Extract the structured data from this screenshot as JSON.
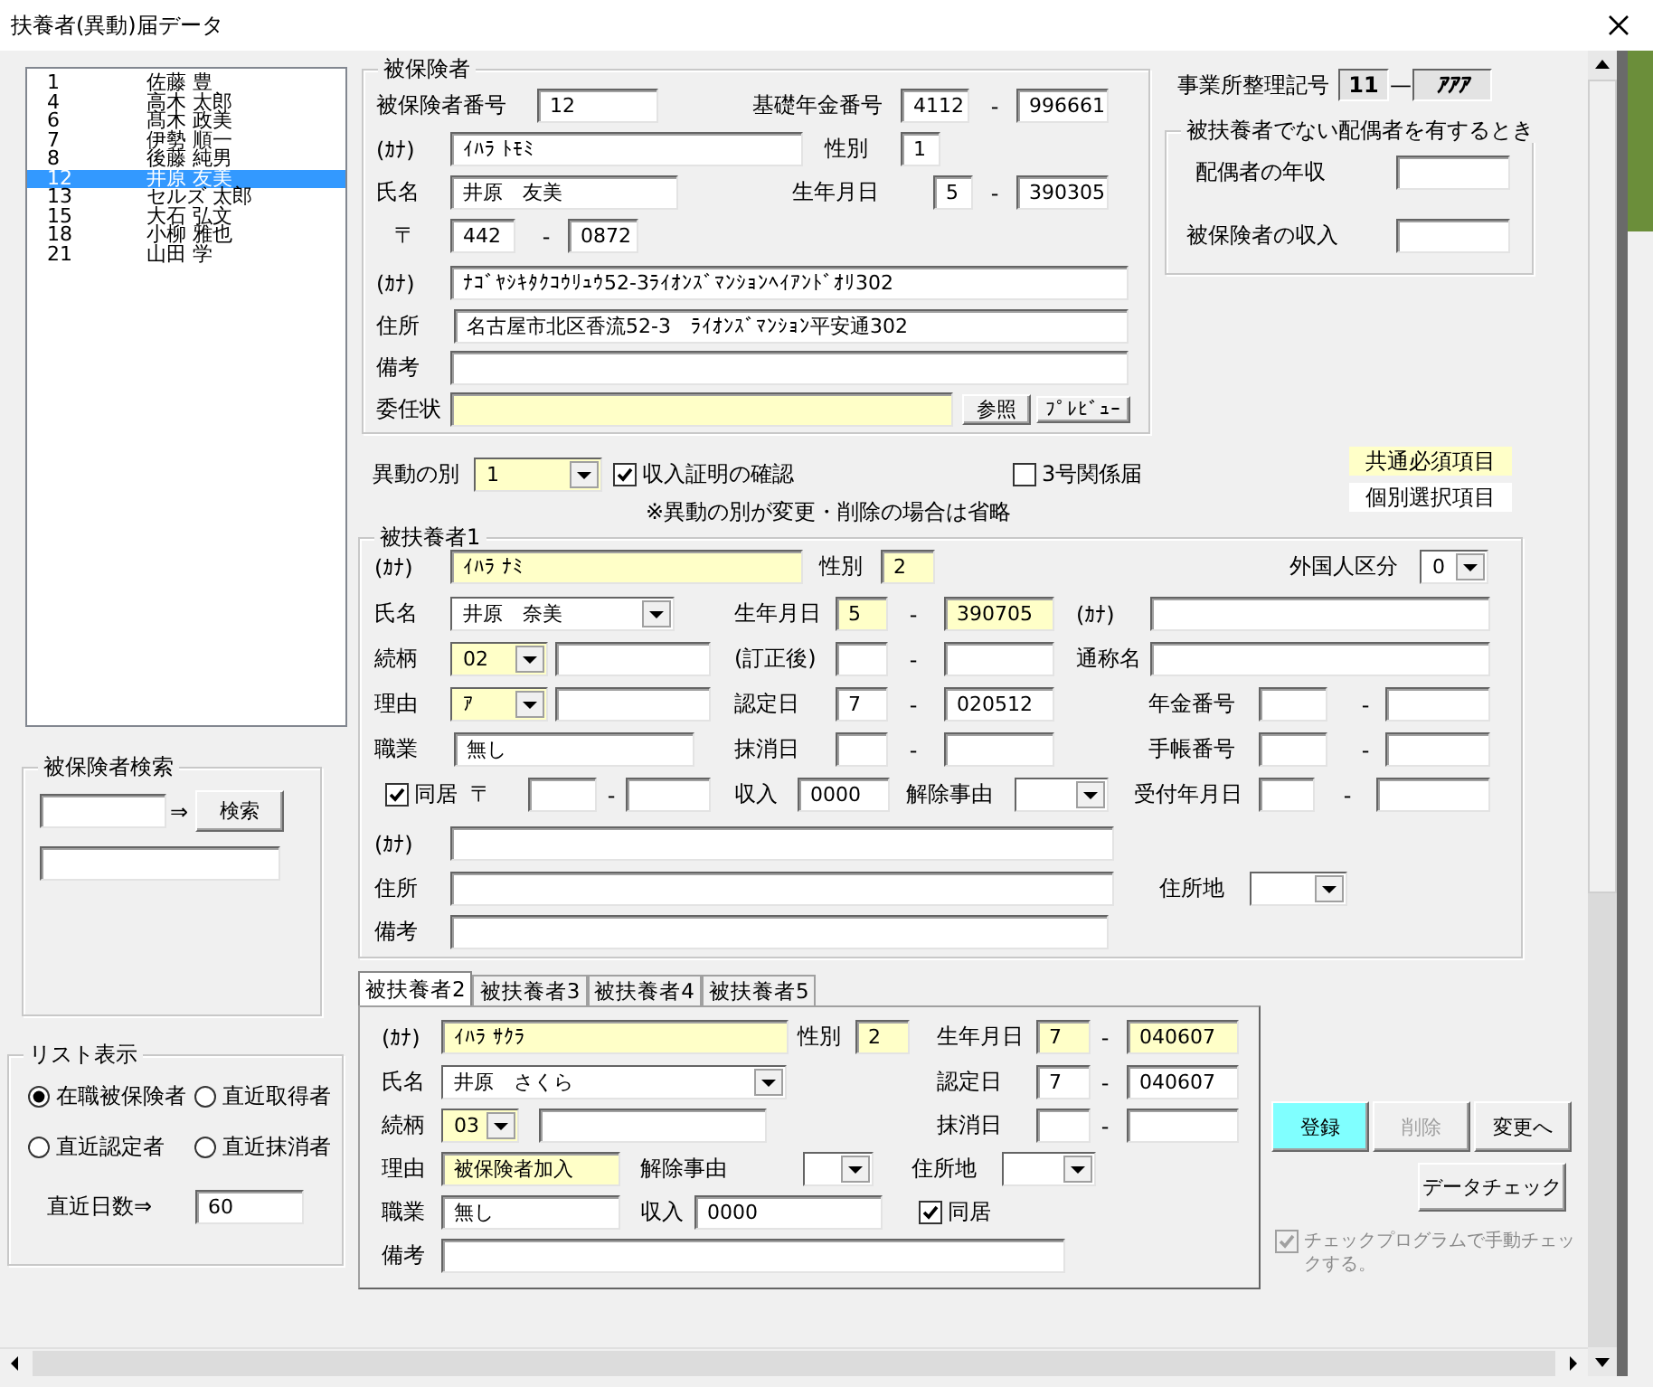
{
  "window": {
    "title": "扶養者(異動)届データ"
  },
  "insured_list": [
    {
      "number": "1",
      "name": "佐藤 豊",
      "selected": false
    },
    {
      "number": "4",
      "name": "高木 太郎",
      "selected": false
    },
    {
      "number": "6",
      "name": "髙木 政美",
      "selected": false
    },
    {
      "number": "7",
      "name": "伊勢 順一",
      "selected": false
    },
    {
      "number": "8",
      "name": "後藤 純男",
      "selected": false
    },
    {
      "number": "12",
      "name": "井原 友美",
      "selected": true
    },
    {
      "number": "13",
      "name": "セルズ 太郎",
      "selected": false
    },
    {
      "number": "15",
      "name": "大石 弘文",
      "selected": false
    },
    {
      "number": "18",
      "name": "小柳 雅也",
      "selected": false
    },
    {
      "number": "21",
      "name": "山田 学",
      "selected": false
    }
  ],
  "search": {
    "title": "被保険者検索",
    "arrow": "⇒",
    "button": "検索"
  },
  "list_display": {
    "title": "リスト表示",
    "options": [
      {
        "label": "在職被保険者",
        "selected": true
      },
      {
        "label": "直近取得者",
        "selected": false
      },
      {
        "label": "直近認定者",
        "selected": false
      },
      {
        "label": "直近抹消者",
        "selected": false
      }
    ],
    "days_label": "直近日数⇒",
    "days": "60"
  },
  "insured": {
    "title": "被保険者",
    "lines": [
      {
        "controls": [
          {
            "kind": "label",
            "text": "被保険者番号"
          },
          {
            "kind": "field",
            "value": "12",
            "required": false
          },
          {
            "kind": "label",
            "text": "基礎年金番号"
          },
          {
            "kind": "field",
            "value": "4112",
            "required": false
          },
          {
            "kind": "dash",
            "text": "-"
          },
          {
            "kind": "field",
            "value": "996661",
            "required": false
          }
        ]
      },
      {
        "controls": [
          {
            "kind": "label",
            "text": "(ｶﾅ)"
          },
          {
            "kind": "field",
            "value": "ｲﾊﾗ ﾄﾓﾐ",
            "required": false
          },
          {
            "kind": "label",
            "text": "性別"
          },
          {
            "kind": "field",
            "value": "1",
            "required": false
          }
        ]
      },
      {
        "controls": [
          {
            "kind": "label",
            "text": "氏名"
          },
          {
            "kind": "field",
            "value": "井原　友美",
            "required": false
          },
          {
            "kind": "label",
            "text": "生年月日"
          },
          {
            "kind": "field",
            "value": "5",
            "required": false
          },
          {
            "kind": "dash",
            "text": "-"
          },
          {
            "kind": "field",
            "value": "390305",
            "required": false
          }
        ]
      },
      {
        "controls": [
          {
            "kind": "label",
            "text": "〒"
          },
          {
            "kind": "field",
            "value": "442",
            "required": false
          },
          {
            "kind": "dash",
            "text": "-"
          },
          {
            "kind": "field",
            "value": "0872",
            "required": false
          }
        ]
      },
      {
        "controls": [
          {
            "kind": "label",
            "text": "(ｶﾅ)"
          },
          {
            "kind": "field",
            "value": "ﾅｺﾞﾔｼｷﾀｸｺｳﾘｭｳ52-3ﾗｲｵﾝｽﾞﾏﾝｼｮﾝﾍｲｱﾝﾄﾞｵﾘ302",
            "required": false
          }
        ]
      },
      {
        "controls": [
          {
            "kind": "label",
            "text": "住所"
          },
          {
            "kind": "field",
            "value": "名古屋市北区香流52-3　ﾗｲｵﾝｽﾞﾏﾝｼｮﾝ平安通302",
            "required": false
          }
        ]
      },
      {
        "controls": [
          {
            "kind": "label",
            "text": "備考"
          },
          {
            "kind": "field",
            "required": false
          }
        ]
      },
      {
        "controls": [
          {
            "kind": "label",
            "text": "委任状"
          },
          {
            "kind": "field",
            "required": true
          },
          {
            "kind": "button",
            "label": "参照"
          },
          {
            "kind": "button",
            "label": "ﾌﾟﾚﾋﾞｭｰ"
          }
        ]
      }
    ]
  },
  "office_code": {
    "label": "事業所整理記号",
    "part1": "11",
    "separator": "—",
    "part2": "ｱｱｱ"
  },
  "spouse": {
    "title": "被扶養者でない配偶者を有するとき",
    "lines": [
      {
        "controls": [
          {
            "kind": "label",
            "text": "配偶者の年収"
          },
          {
            "kind": "field",
            "required": false
          }
        ]
      },
      {
        "controls": [
          {
            "kind": "label",
            "text": "被保険者の収入"
          },
          {
            "kind": "field",
            "required": false
          }
        ]
      }
    ]
  },
  "legend": [
    {
      "text": "共通必須項目",
      "required": true
    },
    {
      "text": "個別選択項目",
      "required": false
    }
  ],
  "change_section": {
    "lines": [
      {
        "controls": [
          {
            "kind": "label",
            "text": "異動の別"
          },
          {
            "kind": "combo",
            "value": "1",
            "required": true
          },
          {
            "kind": "check",
            "label": "収入証明の確認",
            "checked": true
          },
          {
            "kind": "check",
            "label": "3号関係届",
            "checked": false
          }
        ]
      },
      {
        "controls": [
          {
            "kind": "label",
            "text": "※異動の別が変更・削除の場合は省略"
          }
        ]
      }
    ]
  },
  "dependent1": {
    "title": "被扶養者1",
    "lines": [
      {
        "controls": [
          {
            "kind": "label",
            "text": "(ｶﾅ)"
          },
          {
            "kind": "field",
            "value": "ｲﾊﾗ ﾅﾐ",
            "required": true
          },
          {
            "kind": "label",
            "text": "性別"
          },
          {
            "kind": "field",
            "value": "2",
            "required": true
          },
          {
            "kind": "label",
            "text": "外国人区分"
          },
          {
            "kind": "combo",
            "value": "0",
            "required": false
          }
        ]
      },
      {
        "controls": [
          {
            "kind": "label",
            "text": "氏名"
          },
          {
            "kind": "combo",
            "value": "井原　奈美",
            "required": false
          },
          {
            "kind": "label",
            "text": "生年月日"
          },
          {
            "kind": "field",
            "value": "5",
            "required": true
          },
          {
            "kind": "dash",
            "text": "-"
          },
          {
            "kind": "field",
            "value": "390705",
            "required": true
          },
          {
            "kind": "label",
            "text": "(ｶﾅ)"
          },
          {
            "kind": "field",
            "required": false
          }
        ]
      },
      {
        "controls": [
          {
            "kind": "label",
            "text": "続柄"
          },
          {
            "kind": "combo",
            "value": "02",
            "required": true
          },
          {
            "kind": "field",
            "required": false
          },
          {
            "kind": "label",
            "text": "(訂正後)"
          },
          {
            "kind": "field",
            "required": false
          },
          {
            "kind": "dash",
            "text": "-"
          },
          {
            "kind": "field",
            "required": false
          },
          {
            "kind": "label",
            "text": "通称名"
          },
          {
            "kind": "field",
            "required": false
          }
        ]
      },
      {
        "controls": [
          {
            "kind": "label",
            "text": "理由"
          },
          {
            "kind": "combo",
            "value": "ｱ",
            "required": true
          },
          {
            "kind": "field",
            "required": false
          },
          {
            "kind": "label",
            "text": "認定日"
          },
          {
            "kind": "field",
            "value": "7",
            "required": false
          },
          {
            "kind": "dash",
            "text": "-"
          },
          {
            "kind": "field",
            "value": "020512",
            "required": false
          },
          {
            "kind": "label",
            "text": "年金番号"
          },
          {
            "kind": "field",
            "required": false
          },
          {
            "kind": "dash",
            "text": "-"
          },
          {
            "kind": "field",
            "required": false
          }
        ]
      },
      {
        "controls": [
          {
            "kind": "label",
            "text": "職業"
          },
          {
            "kind": "field",
            "value": "無し",
            "required": false
          },
          {
            "kind": "label",
            "text": "抹消日"
          },
          {
            "kind": "field",
            "required": false
          },
          {
            "kind": "dash",
            "text": "-"
          },
          {
            "kind": "field",
            "required": false
          },
          {
            "kind": "label",
            "text": "手帳番号"
          },
          {
            "kind": "field",
            "required": false
          },
          {
            "kind": "dash",
            "text": "-"
          },
          {
            "kind": "field",
            "required": false
          }
        ]
      },
      {
        "controls": [
          {
            "kind": "check",
            "label": "同居",
            "checked": true
          },
          {
            "kind": "label",
            "text": "〒"
          },
          {
            "kind": "field",
            "required": false
          },
          {
            "kind": "dash",
            "text": "-"
          },
          {
            "kind": "field",
            "required": false
          },
          {
            "kind": "label",
            "text": "収入"
          },
          {
            "kind": "field",
            "value": "0000",
            "required": false
          },
          {
            "kind": "label",
            "text": "解除事由"
          },
          {
            "kind": "combo",
            "required": false
          },
          {
            "kind": "label",
            "text": "受付年月日"
          },
          {
            "kind": "field",
            "required": false
          },
          {
            "kind": "dash",
            "text": "-"
          },
          {
            "kind": "field",
            "required": false
          }
        ]
      },
      {
        "controls": [
          {
            "kind": "label",
            "text": "(ｶﾅ)"
          },
          {
            "kind": "field",
            "required": false
          }
        ]
      },
      {
        "controls": [
          {
            "kind": "label",
            "text": "住所"
          },
          {
            "kind": "field",
            "required": false
          },
          {
            "kind": "label",
            "text": "住所地"
          },
          {
            "kind": "combo",
            "required": false
          }
        ]
      },
      {
        "controls": [
          {
            "kind": "label",
            "text": "備考"
          },
          {
            "kind": "field",
            "required": false
          }
        ]
      }
    ]
  },
  "tabs": [
    {
      "label": "被扶養者2",
      "selected": true
    },
    {
      "label": "被扶養者3",
      "selected": false
    },
    {
      "label": "被扶養者4",
      "selected": false
    },
    {
      "label": "被扶養者5",
      "selected": false
    }
  ],
  "tab_panel": {
    "lines": [
      {
        "controls": [
          {
            "kind": "label",
            "text": "(ｶﾅ)"
          },
          {
            "kind": "field",
            "value": "ｲﾊﾗ ｻｸﾗ",
            "required": true
          },
          {
            "kind": "label",
            "text": "性別"
          },
          {
            "kind": "field",
            "value": "2",
            "required": true
          },
          {
            "kind": "label",
            "text": "生年月日"
          },
          {
            "kind": "field",
            "value": "7",
            "required": true
          },
          {
            "kind": "dash",
            "text": "-"
          },
          {
            "kind": "field",
            "value": "040607",
            "required": true
          }
        ]
      },
      {
        "controls": [
          {
            "kind": "label",
            "text": "氏名"
          },
          {
            "kind": "combo",
            "value": "井原　さくら",
            "required": false
          },
          {
            "kind": "label",
            "text": "認定日"
          },
          {
            "kind": "field",
            "value": "7",
            "required": false
          },
          {
            "kind": "dash",
            "text": "-"
          },
          {
            "kind": "field",
            "value": "040607",
            "required": false
          }
        ]
      },
      {
        "controls": [
          {
            "kind": "label",
            "text": "続柄"
          },
          {
            "kind": "combo",
            "value": "03",
            "required": true
          },
          {
            "kind": "field",
            "required": false
          },
          {
            "kind": "label",
            "text": "抹消日"
          },
          {
            "kind": "field",
            "required": false
          },
          {
            "kind": "dash",
            "text": "-"
          },
          {
            "kind": "field",
            "required": false
          }
        ]
      },
      {
        "controls": [
          {
            "kind": "label",
            "text": "理由"
          },
          {
            "kind": "field",
            "value": "被保険者加入",
            "required": true
          },
          {
            "kind": "label",
            "text": "解除事由"
          },
          {
            "kind": "combo",
            "required": false
          },
          {
            "kind": "label",
            "text": "住所地"
          },
          {
            "kind": "combo",
            "required": false
          }
        ]
      },
      {
        "controls": [
          {
            "kind": "label",
            "text": "職業"
          },
          {
            "kind": "field",
            "value": "無し",
            "required": false
          },
          {
            "kind": "label",
            "text": "収入"
          },
          {
            "kind": "field",
            "value": "0000",
            "required": false
          },
          {
            "kind": "check",
            "label": "同居",
            "checked": true
          }
        ]
      },
      {
        "controls": [
          {
            "kind": "label",
            "text": "備考"
          },
          {
            "kind": "field",
            "required": false
          }
        ]
      }
    ]
  },
  "actions": [
    {
      "label": "登録",
      "highlighted": true,
      "disabled": false
    },
    {
      "label": "削除",
      "highlighted": false,
      "disabled": true
    },
    {
      "label": "変更へ",
      "highlighted": false,
      "disabled": false
    }
  ],
  "data_check": {
    "label": "データチェック"
  },
  "manual_check": {
    "label": "チェックプログラムで手動チェックする。",
    "checked": true,
    "disabled": true
  }
}
